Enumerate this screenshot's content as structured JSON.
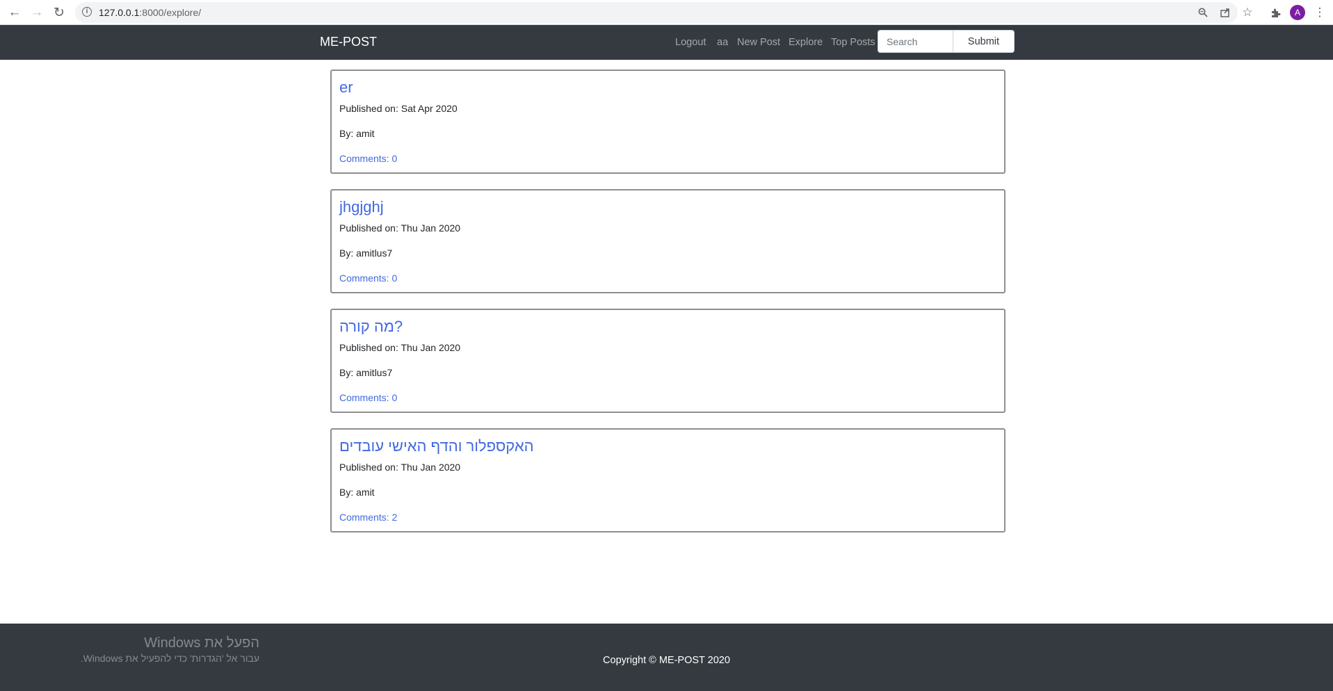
{
  "browser": {
    "url_host": "127.0.0.1",
    "url_rest": ":8000/explore/",
    "avatar_letter": "A",
    "icons": [
      "back-arrow-icon",
      "forward-arrow-icon",
      "reload-icon",
      "site-info-icon",
      "zoom-icon",
      "share-icon",
      "bookmark-star-icon",
      "extensions-icon",
      "menu-kebab-icon"
    ]
  },
  "navbar": {
    "brand": "ME-POST",
    "links": [
      "Logout",
      "aa",
      "New Post",
      "Explore",
      "Top Posts"
    ],
    "search_placeholder": "Search",
    "submit_label": "Submit"
  },
  "posts": [
    {
      "title": "er",
      "published": "Published on: Sat Apr 2020",
      "author": "By: amit",
      "comments": "Comments: 0"
    },
    {
      "title": "jhgjghj",
      "published": "Published on: Thu Jan 2020",
      "author": "By: amitlus7",
      "comments": "Comments: 0"
    },
    {
      "title": "מה קורה?",
      "published": "Published on: Thu Jan 2020",
      "author": "By: amitlus7",
      "comments": "Comments: 0"
    },
    {
      "title": "האקספלור והדף האישי עובדים",
      "published": "Published on: Thu Jan 2020",
      "author": "By: amit",
      "comments": "Comments: 2"
    }
  ],
  "footer": {
    "copyright": "Copyright © ME-POST 2020",
    "watermark_title": "הפעל את Windows",
    "watermark_sub": "עבור אל 'הגדרות' כדי להפעיל את Windows."
  },
  "colors": {
    "navbar_bg": "#343a40",
    "link_blue": "#4169e1",
    "avatar_purple": "#7b1fa2"
  }
}
